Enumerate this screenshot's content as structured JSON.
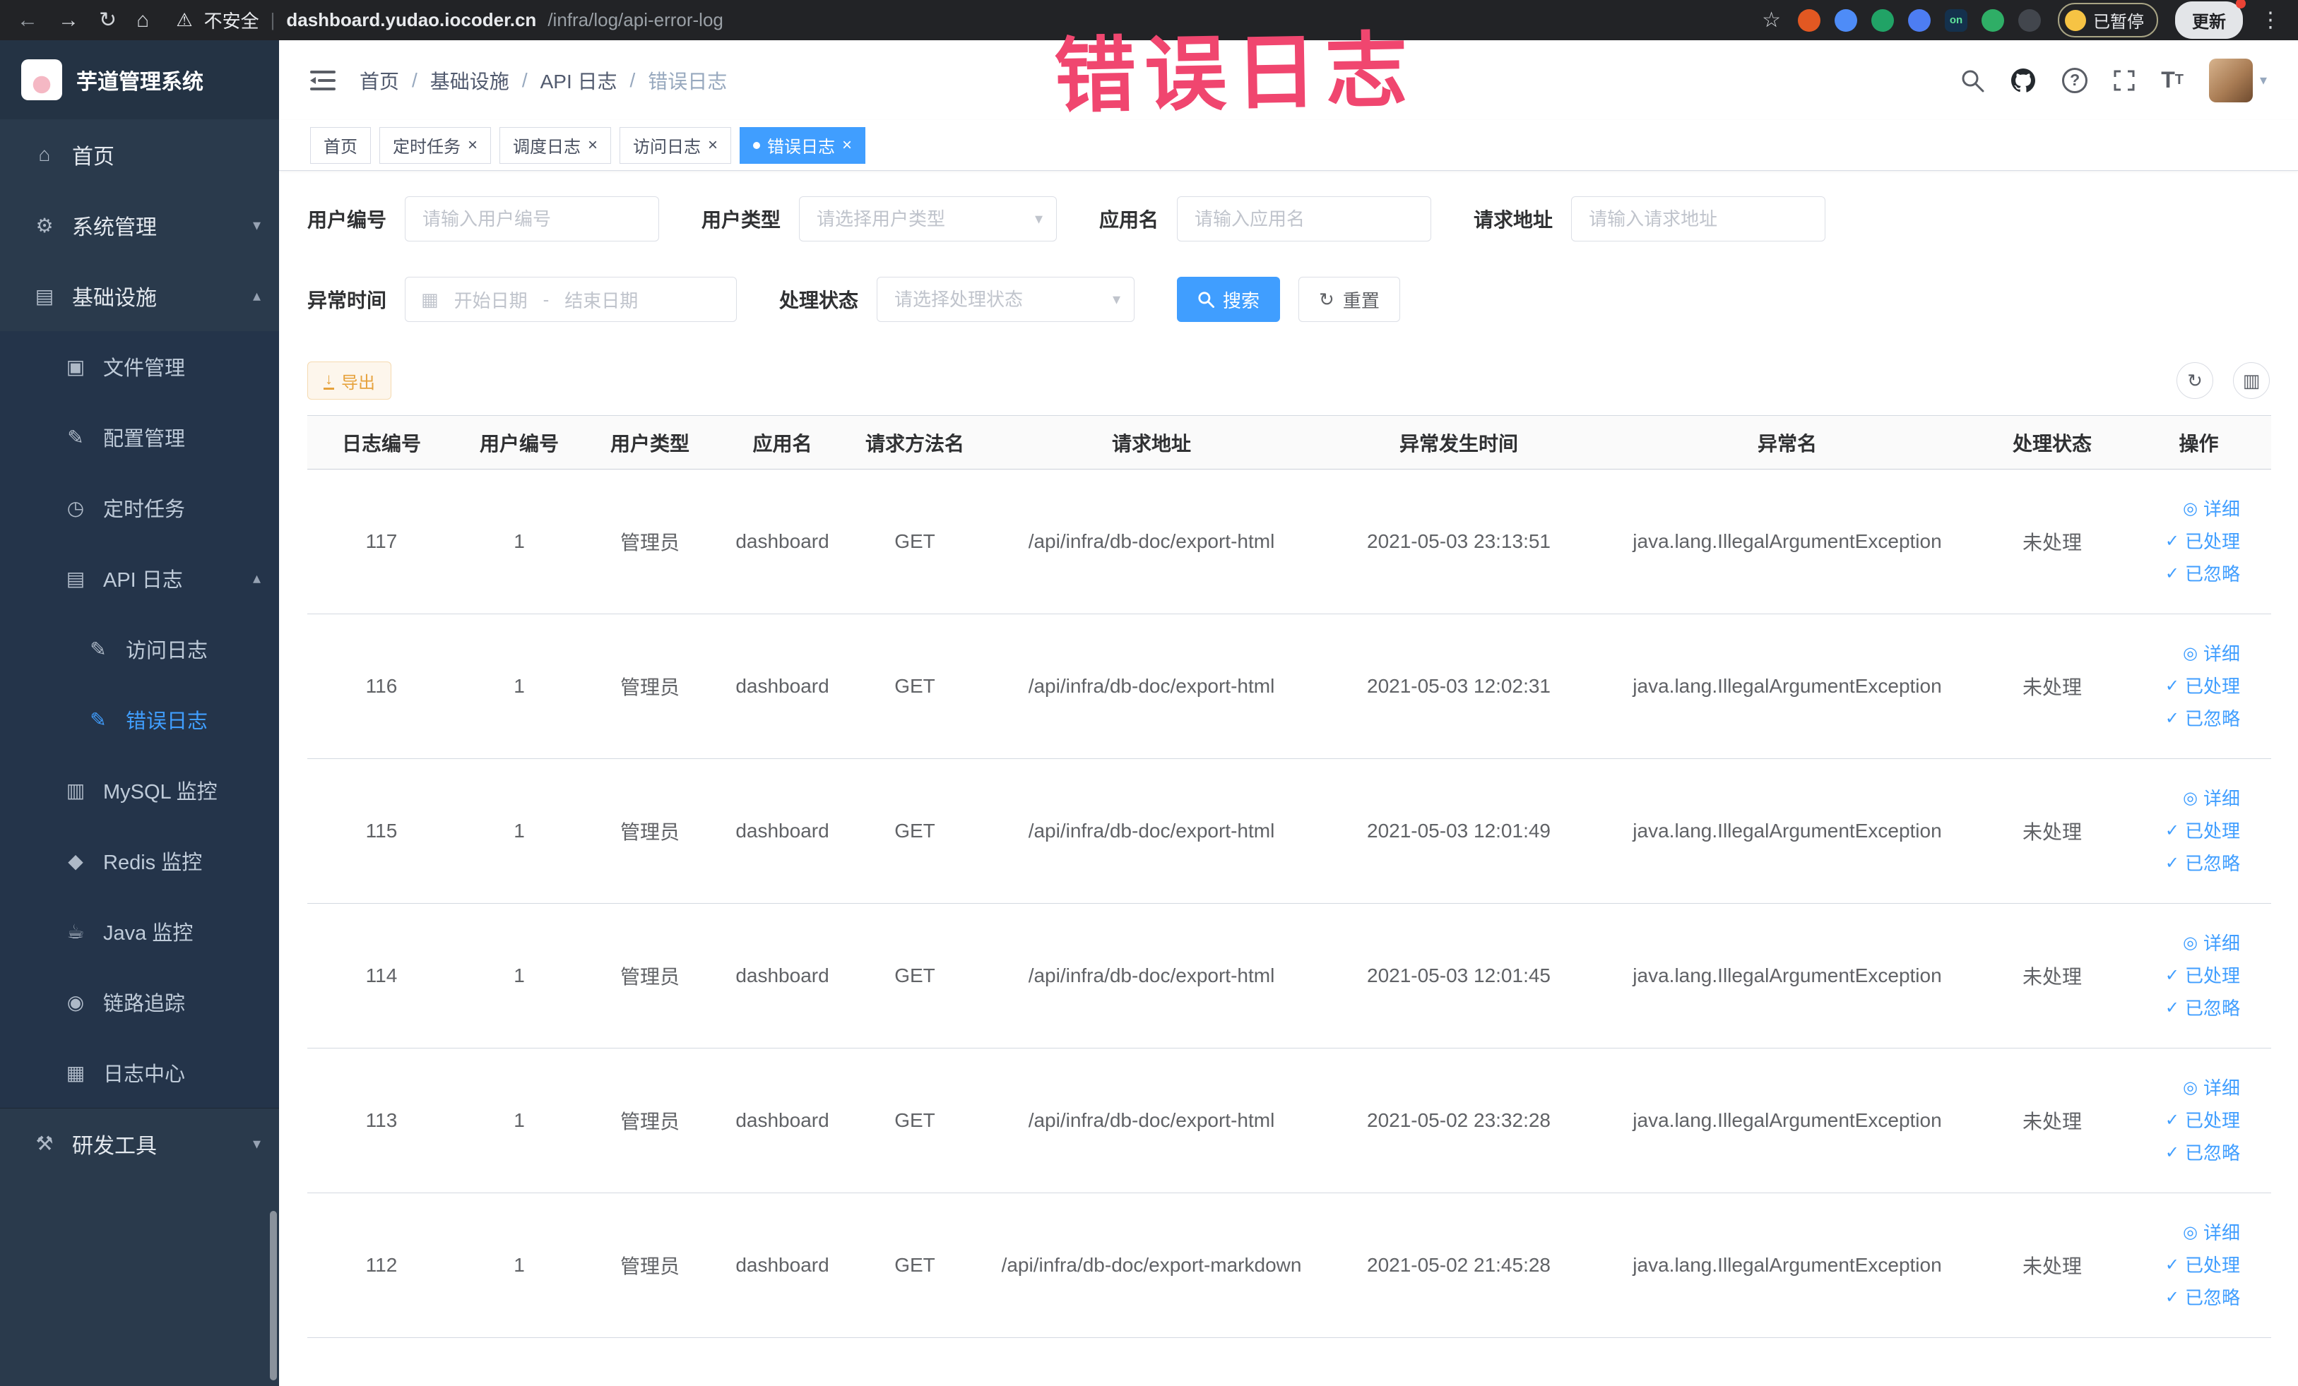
{
  "annotation": {
    "text": "错误日志"
  },
  "browser": {
    "warning_label": "不安全",
    "url_domain": "dashboard.yudao.iocoder.cn",
    "url_path": "/infra/log/api-error-log",
    "paused_badge": "已暂停",
    "update_button": "更新",
    "extensions": [
      {
        "key": "extension-record",
        "color": "#e25822"
      },
      {
        "key": "extension-drop",
        "color": "#4e8cf7"
      },
      {
        "key": "extension-circle-green",
        "color": "#21a366"
      },
      {
        "key": "extension-grid",
        "color": "#4d7df2"
      },
      {
        "key": "extension-on-switch",
        "color": "#14314d",
        "label": "on",
        "label_color": "#5fe39a"
      },
      {
        "key": "extension-sprout",
        "color": "#2fae66"
      },
      {
        "key": "extension-paw",
        "color": "#42464d"
      }
    ]
  },
  "sidebar": {
    "app_title": "芋道管理系统",
    "items": [
      {
        "key": "home",
        "label": "首页",
        "icon": "home-icon",
        "level": 1
      },
      {
        "key": "system-management",
        "label": "系统管理",
        "icon": "gear-icon",
        "level": 1,
        "chevron": "down"
      },
      {
        "key": "infrastructure",
        "label": "基础设施",
        "icon": "monitor-icon",
        "level": 1,
        "chevron": "up"
      },
      {
        "key": "file-management",
        "label": "文件管理",
        "icon": "folder-icon",
        "level": 2
      },
      {
        "key": "config-management",
        "label": "配置管理",
        "icon": "edit-icon",
        "level": 2
      },
      {
        "key": "scheduled-tasks",
        "label": "定时任务",
        "icon": "timer-icon",
        "level": 2
      },
      {
        "key": "api-log",
        "label": "API 日志",
        "icon": "log-icon",
        "level": 2,
        "chevron": "up"
      },
      {
        "key": "access-log",
        "label": "访问日志",
        "icon": "doc-edit-icon",
        "level": 3
      },
      {
        "key": "error-log",
        "label": "错误日志",
        "icon": "doc-edit-icon",
        "level": 3,
        "active": true
      },
      {
        "key": "mysql-monitor",
        "label": "MySQL 监控",
        "icon": "database-icon",
        "level": 2
      },
      {
        "key": "redis-monitor",
        "label": "Redis 监控",
        "icon": "redis-icon",
        "level": 2
      },
      {
        "key": "java-monitor",
        "label": "Java 监控",
        "icon": "java-icon",
        "level": 2
      },
      {
        "key": "link-tracing",
        "label": "链路追踪",
        "icon": "eye-icon",
        "level": 2
      },
      {
        "key": "log-center",
        "label": "日志中心",
        "icon": "log-center-icon",
        "level": 2
      },
      {
        "key": "dev-tools",
        "label": "研发工具",
        "icon": "tools-icon",
        "level": 1,
        "chevron": "down",
        "section": "bottom"
      }
    ]
  },
  "navbar": {
    "breadcrumb": [
      {
        "label": "首页"
      },
      {
        "label": "基础设施"
      },
      {
        "label": "API 日志"
      },
      {
        "label": "错误日志",
        "current": true
      }
    ]
  },
  "tabs": [
    {
      "label": "首页",
      "closable": false,
      "active": false
    },
    {
      "label": "定时任务",
      "closable": true,
      "active": false
    },
    {
      "label": "调度日志",
      "closable": true,
      "active": false
    },
    {
      "label": "访问日志",
      "closable": true,
      "active": false
    },
    {
      "label": "错误日志",
      "closable": true,
      "active": true
    }
  ],
  "filters": {
    "user_id": {
      "label": "用户编号",
      "placeholder": "请输入用户编号"
    },
    "user_type": {
      "label": "用户类型",
      "placeholder": "请选择用户类型"
    },
    "app_name": {
      "label": "应用名",
      "placeholder": "请输入应用名"
    },
    "request_url": {
      "label": "请求地址",
      "placeholder": "请输入请求地址"
    },
    "exception_time": {
      "label": "异常时间",
      "start_placeholder": "开始日期",
      "separator": "-",
      "end_placeholder": "结束日期"
    },
    "process_status": {
      "label": "处理状态",
      "placeholder": "请选择处理状态"
    },
    "search_button": "搜索",
    "reset_button": "重置"
  },
  "toolbar": {
    "export_label": "导出"
  },
  "table": {
    "columns": [
      "日志编号",
      "用户编号",
      "用户类型",
      "应用名",
      "请求方法名",
      "请求地址",
      "异常发生时间",
      "异常名",
      "处理状态",
      "操作"
    ],
    "rows": [
      {
        "log_id": "117",
        "user_id": "1",
        "user_type": "管理员",
        "app_name": "dashboard",
        "method": "GET",
        "request_url": "/api/infra/db-doc/export-html",
        "exception_time": "2021-05-03 23:13:51",
        "exception_name": "java.lang.IllegalArgumentException",
        "status": "未处理"
      },
      {
        "log_id": "116",
        "user_id": "1",
        "user_type": "管理员",
        "app_name": "dashboard",
        "method": "GET",
        "request_url": "/api/infra/db-doc/export-html",
        "exception_time": "2021-05-03 12:02:31",
        "exception_name": "java.lang.IllegalArgumentException",
        "status": "未处理"
      },
      {
        "log_id": "115",
        "user_id": "1",
        "user_type": "管理员",
        "app_name": "dashboard",
        "method": "GET",
        "request_url": "/api/infra/db-doc/export-html",
        "exception_time": "2021-05-03 12:01:49",
        "exception_name": "java.lang.IllegalArgumentException",
        "status": "未处理"
      },
      {
        "log_id": "114",
        "user_id": "1",
        "user_type": "管理员",
        "app_name": "dashboard",
        "method": "GET",
        "request_url": "/api/infra/db-doc/export-html",
        "exception_time": "2021-05-03 12:01:45",
        "exception_name": "java.lang.IllegalArgumentException",
        "status": "未处理"
      },
      {
        "log_id": "113",
        "user_id": "1",
        "user_type": "管理员",
        "app_name": "dashboard",
        "method": "GET",
        "request_url": "/api/infra/db-doc/export-html",
        "exception_time": "2021-05-02 23:32:28",
        "exception_name": "java.lang.IllegalArgumentException",
        "status": "未处理"
      },
      {
        "log_id": "112",
        "user_id": "1",
        "user_type": "管理员",
        "app_name": "dashboard",
        "method": "GET",
        "request_url": "/api/infra/db-doc/export-markdown",
        "exception_time": "2021-05-02 21:45:28",
        "exception_name": "java.lang.IllegalArgumentException",
        "status": "未处理"
      }
    ],
    "row_actions": [
      {
        "label": "详细",
        "icon": "view-icon",
        "name": "action-detail-link"
      },
      {
        "label": "已处理",
        "icon": "check-icon",
        "name": "action-mark-processed-link"
      },
      {
        "label": "已忽略",
        "icon": "check-icon",
        "name": "action-mark-ignored-link"
      }
    ]
  }
}
